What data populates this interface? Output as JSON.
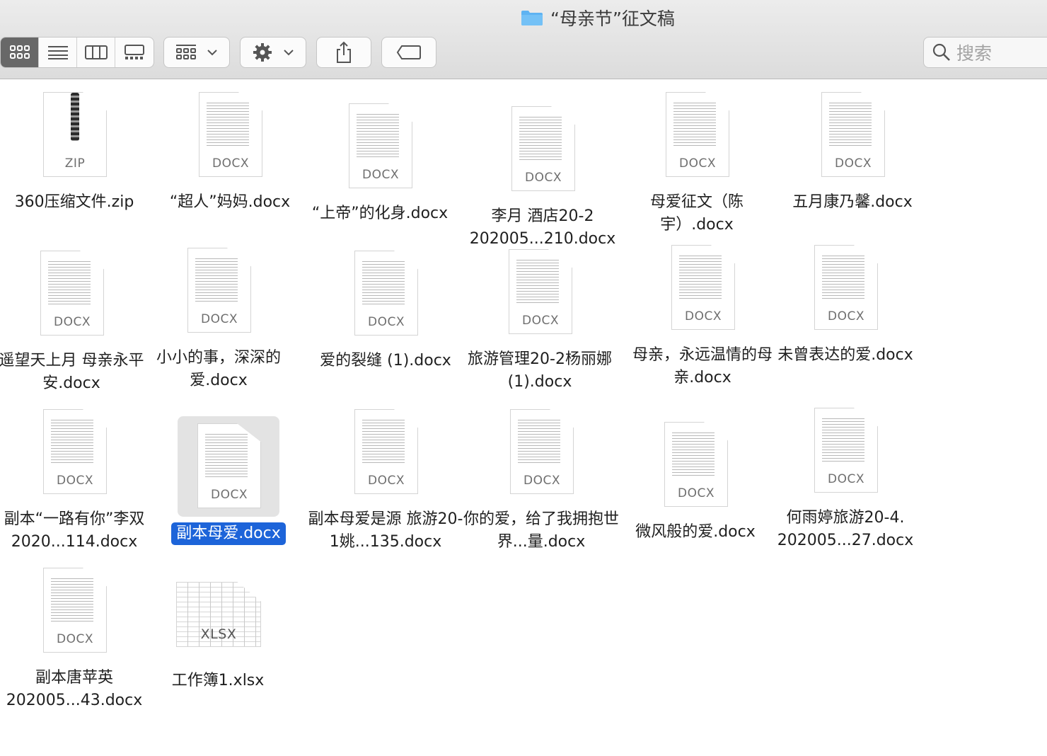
{
  "window": {
    "title": "“母亲节”征文稿"
  },
  "search": {
    "placeholder": "搜索"
  },
  "files": [
    {
      "name": "360压缩文件.zip",
      "ext": "ZIP",
      "kind": "zip"
    },
    {
      "name": "“超人”妈妈.docx",
      "ext": "DOCX"
    },
    {
      "name": "“上帝”的化身.docx",
      "ext": "DOCX"
    },
    {
      "name": "李月 酒店20-2 202005...210.docx",
      "ext": "DOCX"
    },
    {
      "name": "母爱征文（陈宇）.docx",
      "ext": "DOCX"
    },
    {
      "name": "五月康乃馨.docx",
      "ext": "DOCX"
    },
    {
      "name": "遥望天上月 母亲永平安.docx",
      "ext": "DOCX"
    },
    {
      "name": "小小的事，深深的爱.docx",
      "ext": "DOCX"
    },
    {
      "name": "爱的裂缝 (1).docx",
      "ext": "DOCX"
    },
    {
      "name": "旅游管理20-2杨丽娜 (1).docx",
      "ext": "DOCX"
    },
    {
      "name": "母亲，永远温情的母亲.docx",
      "ext": "DOCX"
    },
    {
      "name": "未曾表达的爱.docx",
      "ext": "DOCX"
    },
    {
      "name": "副本“一路有你”李双 2020...114.docx",
      "ext": "DOCX"
    },
    {
      "name": "副本母爱.docx",
      "ext": "DOCX",
      "selected": true
    },
    {
      "name": "副本母爱是源 旅游20-1姚...135.docx",
      "ext": "DOCX"
    },
    {
      "name": "你的爱，给了我拥抱世界...量.docx",
      "ext": "DOCX"
    },
    {
      "name": "微风般的爱.docx",
      "ext": "DOCX"
    },
    {
      "name": "何雨婷旅游20-4. 202005...27.docx",
      "ext": "DOCX"
    },
    {
      "name": "副本唐苹英 202005...43.docx",
      "ext": "DOCX"
    },
    {
      "name": "工作簿1.xlsx",
      "ext": "XLSX",
      "kind": "xlsx"
    }
  ],
  "colors": {
    "selection": "#1d64d9",
    "folder": "#5eb3f2"
  }
}
